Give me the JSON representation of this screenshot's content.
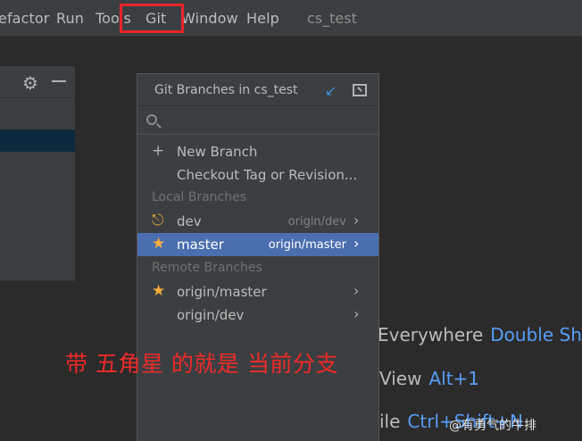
{
  "menubar": {
    "items": [
      {
        "label": "efactor"
      },
      {
        "label": "Run"
      },
      {
        "label": "Tools"
      },
      {
        "label": "Git"
      },
      {
        "label": "Window"
      },
      {
        "label": "Help"
      }
    ],
    "window_title": "cs_test",
    "highlight_color": "#e8252b"
  },
  "popup": {
    "title": "Git Branches in cs_test",
    "search_placeholder": "",
    "actions": [
      {
        "label": "New Branch",
        "icon": "plus-icon"
      },
      {
        "label": "Checkout Tag or Revision...",
        "icon": ""
      }
    ],
    "local_section": "Local Branches",
    "local_branches": [
      {
        "name": "dev",
        "tracking": "origin/dev",
        "icon": "tag-icon",
        "selected": false
      },
      {
        "name": "master",
        "tracking": "origin/master",
        "icon": "star-icon",
        "selected": true
      }
    ],
    "remote_section": "Remote Branches",
    "remote_branches": [
      {
        "name": "origin/master",
        "icon": "star-icon"
      },
      {
        "name": "origin/dev",
        "icon": ""
      }
    ]
  },
  "background_hints": [
    {
      "action": "Everywhere",
      "shortcut": "Double Shift"
    },
    {
      "action": "View",
      "shortcut": "Alt+1"
    },
    {
      "action": "ile",
      "shortcut": "Ctrl+Shift+N"
    }
  ],
  "annotation": "带 五角星 的就是 当前分支",
  "watermark": "@有勇气的牛排",
  "colors": {
    "accent": "#4b6eaf",
    "star": "#f4af3d",
    "annotation": "#ee2a2a",
    "shortcut": "#589df6"
  }
}
